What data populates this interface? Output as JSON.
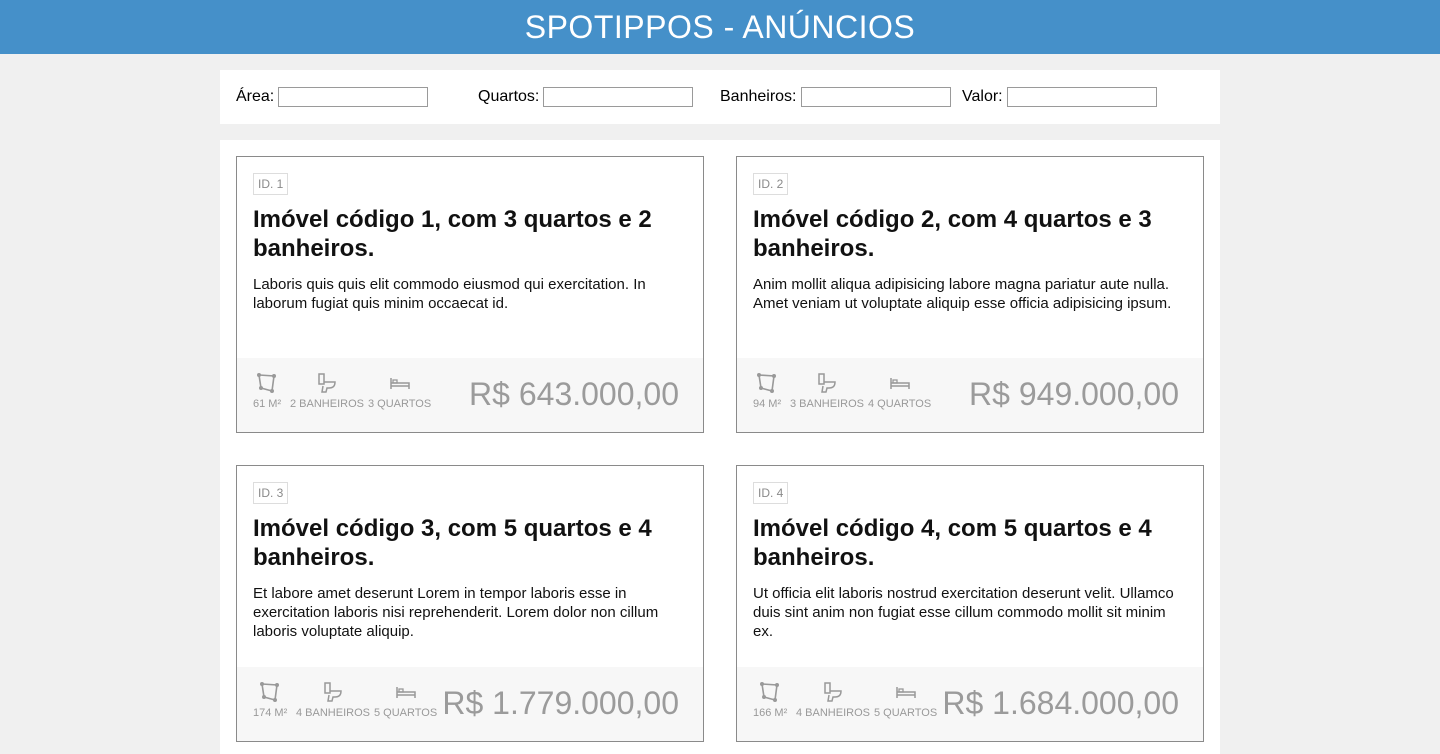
{
  "header": {
    "title": "SPOTIPPOS - ANÚNCIOS"
  },
  "filters": {
    "area_label": "Área:",
    "quartos_label": "Quartos:",
    "banheiros_label": "Banheiros:",
    "valor_label": "Valor:",
    "area_value": "",
    "quartos_value": "",
    "banheiros_value": "",
    "valor_value": ""
  },
  "listings": [
    {
      "id": "ID. 1",
      "title": "Imóvel código 1, com 3 quartos e 2 banheiros.",
      "description": "Laboris quis quis elit commodo eiusmod qui exercitation. In laborum fugiat quis minim occaecat id.",
      "area": "61 M²",
      "baths": "2 BANHEIROS",
      "beds": "3 QUARTOS",
      "price": "R$ 643.000,00"
    },
    {
      "id": "ID. 2",
      "title": "Imóvel código 2, com 4 quartos e 3 banheiros.",
      "description": "Anim mollit aliqua adipisicing labore magna pariatur aute nulla. Amet veniam ut voluptate aliquip esse officia adipisicing ipsum.",
      "area": "94 M²",
      "baths": "3 BANHEIROS",
      "beds": "4 QUARTOS",
      "price": "R$ 949.000,00"
    },
    {
      "id": "ID. 3",
      "title": "Imóvel código 3, com 5 quartos e 4 banheiros.",
      "description": "Et labore amet deserunt Lorem in tempor laboris esse in exercitation laboris nisi reprehenderit. Lorem dolor non cillum laboris voluptate aliquip.",
      "area": "174 M²",
      "baths": "4 BANHEIROS",
      "beds": "5 QUARTOS",
      "price": "R$ 1.779.000,00"
    },
    {
      "id": "ID. 4",
      "title": "Imóvel código 4, com 5 quartos e 4 banheiros.",
      "description": "Ut officia elit laboris nostrud exercitation deserunt velit. Ullamco duis sint anim non fugiat esse cillum commodo mollit sit minim ex.",
      "area": "166 M²",
      "baths": "4 BANHEIROS",
      "beds": "5 QUARTOS",
      "price": "R$ 1.684.000,00"
    }
  ],
  "icons": {
    "area": "area-polygon-icon",
    "baths": "toilet-icon",
    "beds": "bed-icon"
  },
  "colors": {
    "header": "#4590c9",
    "price": "#9b9b9b",
    "background": "#f0f0f0"
  }
}
